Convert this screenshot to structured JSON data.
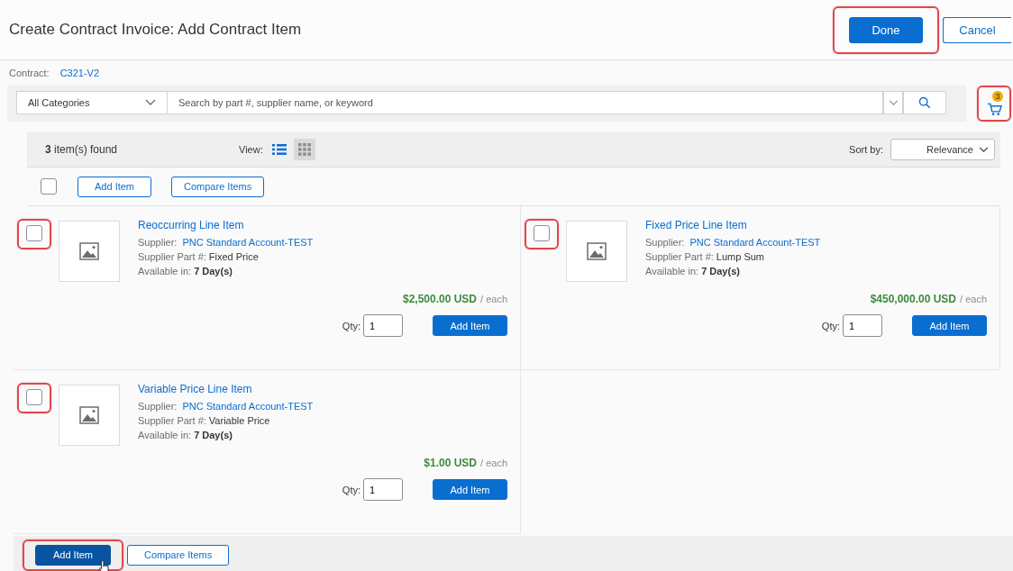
{
  "page": {
    "title": "Create Contract Invoice: Add Contract Item",
    "actions": [
      {
        "label": "Done",
        "kind": "primary",
        "highlighted": true
      },
      {
        "label": "Cancel",
        "kind": "secondary",
        "highlighted": false
      }
    ]
  },
  "contract": {
    "label": "Contract:",
    "value": "C321-V2"
  },
  "search": {
    "category": "All Categories",
    "placeholder": "Search by part #, supplier name, or keyword"
  },
  "cart": {
    "count": "3",
    "highlighted": true
  },
  "results": {
    "count": "3",
    "count_label": "item(s) found",
    "view_label": "View:",
    "views": [
      {
        "kind": "list",
        "selected": false
      },
      {
        "kind": "grid",
        "selected": true
      }
    ],
    "sort_label": "Sort by:",
    "sort_value": "Relevance"
  },
  "toolbar": {
    "select_all_checked": false,
    "buttons": [
      "Add Item",
      "Compare Items"
    ]
  },
  "items": [
    {
      "title": "Reoccurring Line Item",
      "supplier_label": "Supplier:",
      "supplier": "PNC Standard Account-TEST",
      "part_label": "Supplier Part #:",
      "part": "Fixed Price",
      "available_label": "Available in:",
      "available": "7 Day(s)",
      "price": "$2,500.00 USD",
      "unit": "/ each",
      "qty_label": "Qty:",
      "qty": "1",
      "add_label": "Add Item",
      "checked": false,
      "highlighted": true
    },
    {
      "title": "Fixed Price Line Item",
      "supplier_label": "Supplier:",
      "supplier": "PNC Standard Account-TEST",
      "part_label": "Supplier Part #:",
      "part": "Lump Sum",
      "available_label": "Available in:",
      "available": "7 Day(s)",
      "price": "$450,000.00 USD",
      "unit": "/ each",
      "qty_label": "Qty:",
      "qty": "1",
      "add_label": "Add Item",
      "checked": false,
      "highlighted": true
    },
    {
      "title": "Variable Price Line Item",
      "supplier_label": "Supplier:",
      "supplier": "PNC Standard Account-TEST",
      "part_label": "Supplier Part #:",
      "part": "Variable Price",
      "available_label": "Available in:",
      "available": "7 Day(s)",
      "price": "$1.00 USD",
      "unit": "/ each",
      "qty_label": "Qty:",
      "qty": "1",
      "add_label": "Add Item",
      "checked": false,
      "highlighted": true
    }
  ],
  "footer": {
    "buttons": [
      {
        "label": "Add Item",
        "kind": "primary",
        "highlighted": true
      },
      {
        "label": "Compare Items",
        "kind": "secondary",
        "highlighted": false
      }
    ]
  }
}
